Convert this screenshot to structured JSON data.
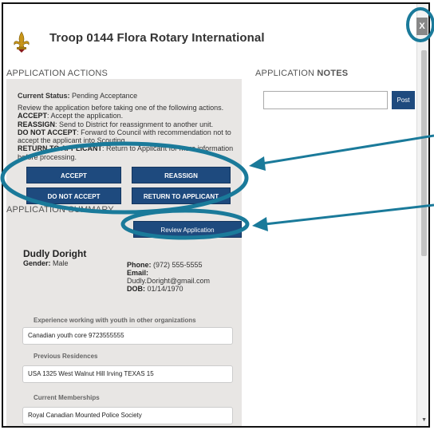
{
  "header": {
    "title": "Troop 0144 Flora Rotary International"
  },
  "window": {
    "close_label": "X"
  },
  "actions": {
    "heading": "APPLICATION ACTIONS",
    "status_label": "Current Status:",
    "status_value": "Pending Acceptance",
    "intro": "Review the application before taking one of the following actions.",
    "items": [
      {
        "key": "ACCEPT",
        "desc": ": Accept the application."
      },
      {
        "key": "REASSIGN",
        "desc": ": Send to District for reassignment to another unit."
      },
      {
        "key": "DO NOT ACCEPT",
        "desc": ": Forward to Council with recommendation not to accept the applicant into Scouting."
      },
      {
        "key": "RETURN TO APPLICANT",
        "desc": ": Return to Applicant for more information before processing."
      }
    ],
    "buttons": {
      "accept": "ACCEPT",
      "reassign": "REASSIGN",
      "do_not_accept": "DO NOT ACCEPT",
      "return": "RETURN TO APPLICANT"
    }
  },
  "summary": {
    "heading": "APPLICATION SUMMARY",
    "review_button": "Review Application",
    "name": "Dudly Doright",
    "gender_label": "Gender:",
    "gender": "Male",
    "phone_label": "Phone:",
    "phone": "(972) 555-5555",
    "email_label": "Email:",
    "email": "Dudly.Doright@gmail.com",
    "dob_label": "DOB:",
    "dob": "01/14/1970",
    "fields": [
      {
        "label": "Experience working with youth in other organizations",
        "value": "Canadian youth core 9723555555"
      },
      {
        "label": "Previous Residences",
        "value": "USA 1325 West Walnut Hill Irving TEXAS 15"
      },
      {
        "label": "Current Memberships",
        "value": "Royal Canadian Mounted Police Society"
      }
    ]
  },
  "notes": {
    "heading_prefix": "APPLICATION",
    "heading_bold": "NOTES",
    "post_label": "Post",
    "input_value": ""
  },
  "colors": {
    "button": "#1e4a7e",
    "annotation": "#1a7a9a",
    "panel": "#e8e6e4"
  }
}
